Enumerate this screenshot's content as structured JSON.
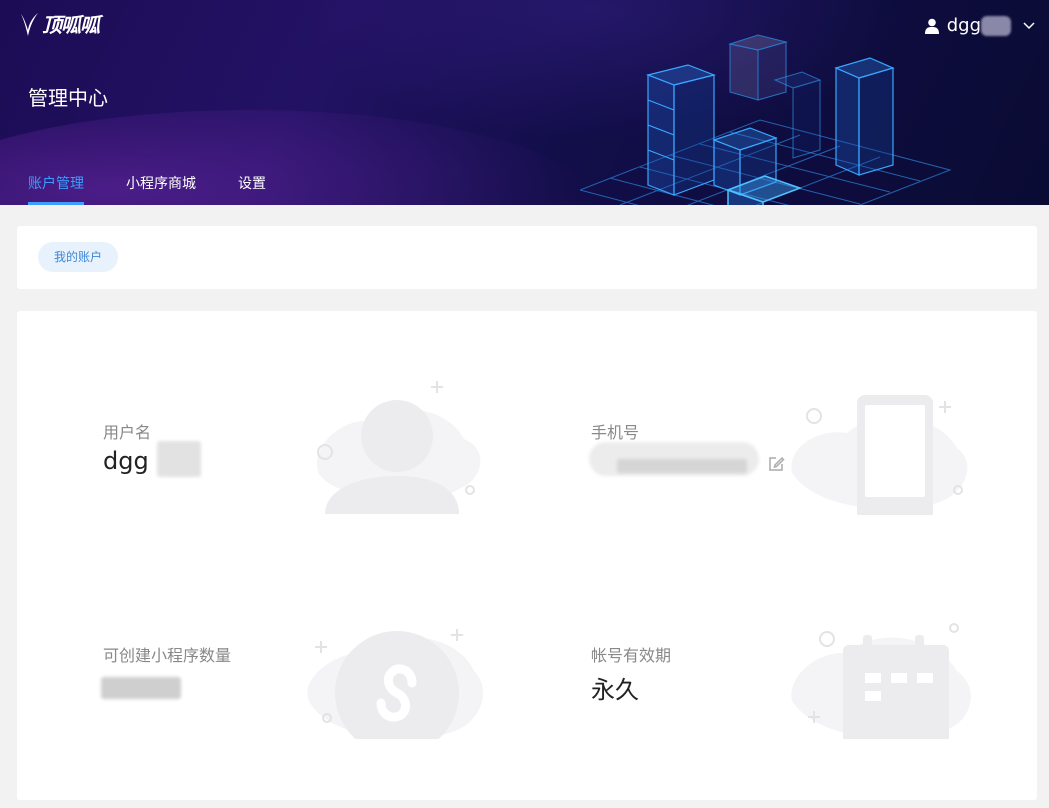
{
  "header": {
    "logo_text": "顶呱呱",
    "page_title": "管理中心",
    "user_name": "dgg",
    "tabs": [
      {
        "label": "账户管理",
        "active": true
      },
      {
        "label": "小程序商城",
        "active": false
      },
      {
        "label": "设置",
        "active": false
      }
    ]
  },
  "breadcrumb": {
    "pill_label": "我的账户"
  },
  "account": {
    "username": {
      "label": "用户名",
      "value": "dgg"
    },
    "phone": {
      "label": "手机号",
      "value": ""
    },
    "miniapp_quota": {
      "label": "可创建小程序数量",
      "value": ""
    },
    "validity": {
      "label": "帐号有效期",
      "value": "永久"
    }
  },
  "colors": {
    "accent": "#3e9dff",
    "header_bg": "#1c0c55",
    "illustration": "#ececee"
  },
  "icons": [
    "user-icon",
    "chevron-down-icon",
    "edit-icon",
    "person-illustration-icon",
    "phone-illustration-icon",
    "miniprogram-illustration-icon",
    "calendar-illustration-icon"
  ]
}
